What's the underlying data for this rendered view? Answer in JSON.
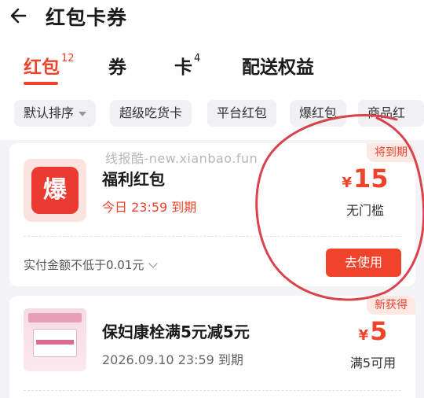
{
  "header": {
    "title": "红包卡券"
  },
  "tabs": [
    {
      "label": "红包",
      "count": "12"
    },
    {
      "label": "券",
      "count": ""
    },
    {
      "label": "卡",
      "count": "4"
    },
    {
      "label": "配送权益",
      "count": ""
    }
  ],
  "filters": [
    "默认排序",
    "超级吃货卡",
    "平台红包",
    "爆红包",
    "商品红"
  ],
  "watermark": "线报酷-new.xianbao.fun",
  "coupons": [
    {
      "badge": "将到期",
      "logo_text": "爆",
      "name": "福利红包",
      "expiry": "今日 23:59 到期",
      "currency": "¥",
      "amount": "15",
      "condition": "无门槛",
      "min_note": "实付金额不低于0.01元",
      "action": "去使用"
    },
    {
      "badge": "新获得",
      "name": "保妇康栓满5元减5元",
      "expiry": "2026.09.10 23:59 到期",
      "currency": "¥",
      "amount": "5",
      "condition": "满5可用"
    }
  ],
  "colors": {
    "accent": "#f0432c",
    "highlight_circle": "#d8434e",
    "page_background": "#f4f4f6"
  },
  "icons": [
    "back-arrow-icon",
    "caret-down-icon",
    "chevron-down-icon"
  ]
}
